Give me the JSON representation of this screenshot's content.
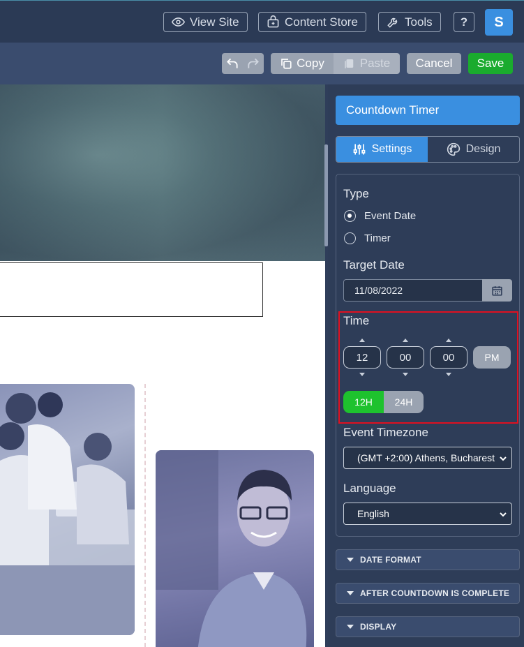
{
  "topbar": {
    "view_site": "View Site",
    "content_store": "Content Store",
    "tools": "Tools",
    "help": "?",
    "avatar": "S"
  },
  "toolbar": {
    "copy": "Copy",
    "paste": "Paste",
    "cancel": "Cancel",
    "save": "Save"
  },
  "colors": {
    "accent": "#3a8fe0",
    "save": "#1aab2e",
    "highlight": "#e01020"
  },
  "panel": {
    "title": "Countdown Timer",
    "tabs": {
      "settings": "Settings",
      "design": "Design"
    },
    "type_label": "Type",
    "type_options": [
      "Event Date",
      "Timer"
    ],
    "type_selected": "Event Date",
    "target_date_label": "Target Date",
    "target_date_value": "11/08/2022",
    "time_label": "Time",
    "hour": "12",
    "minute": "00",
    "second": "00",
    "ampm": "PM",
    "format_12": "12H",
    "format_24": "24H",
    "format_selected": "12H",
    "timezone_label": "Event Timezone",
    "timezone_value": "(GMT +2:00) Athens, Bucharest",
    "language_label": "Language",
    "language_value": "English",
    "accordions": [
      "DATE FORMAT",
      "AFTER COUNTDOWN IS COMPLETE",
      "DISPLAY"
    ]
  }
}
